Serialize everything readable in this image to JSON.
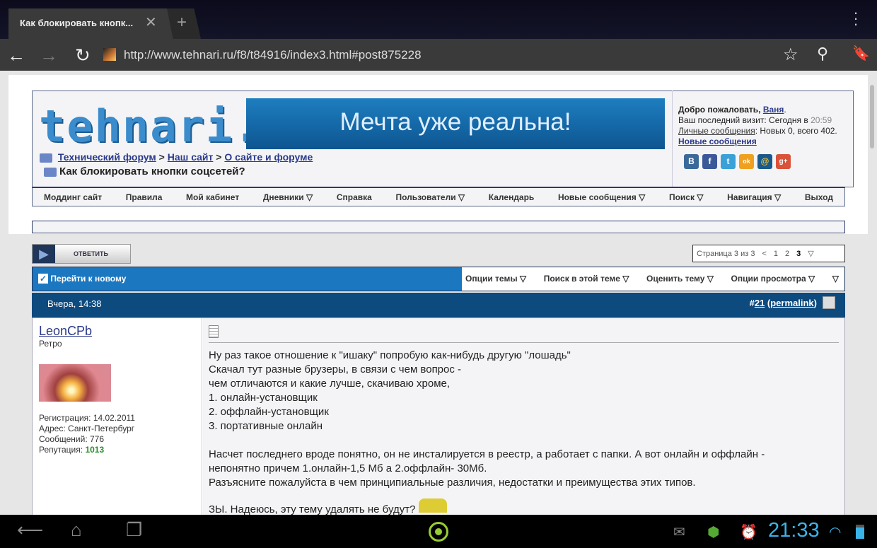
{
  "browser": {
    "tab_title": "Как блокировать кнопк...",
    "url": "http://www.tehnari.ru/f8/t84916/index3.html#post875228"
  },
  "site": {
    "logo": "tehnari.ru",
    "banner": "Мечта уже реальна!",
    "breadcrumb": [
      "Технический форум",
      "Наш сайт",
      "О сайте и форуме"
    ],
    "sep": ">",
    "thread_title": "Как блокировать кнопки соцсетей?"
  },
  "welcome": {
    "greeting": "Добро пожаловать,",
    "user": "Ваня",
    "dot": ".",
    "last_visit": "Ваш последний визит: Сегодня в",
    "last_time": "20:59",
    "pm_label": "Личные сообщения",
    "pm_value": ": Новых 0, всего 402.",
    "new_posts": "Новые сообщения",
    "social": [
      "B",
      "f",
      "t",
      "ok",
      "@",
      "g+"
    ]
  },
  "nav": [
    "Моддинг сайт",
    "Правила",
    "Мой кабинет",
    "Дневники ▽",
    "Справка",
    "Пользователи ▽",
    "Календарь",
    "Новые сообщения ▽",
    "Поиск ▽",
    "Навигация ▽",
    "Выход"
  ],
  "reply_label": "ОТВЕТИТЬ",
  "pager": {
    "label": "Страница 3 из 3",
    "prev": "<",
    "pages": [
      "1",
      "2",
      "3"
    ],
    "menu": "▽"
  },
  "thread_tools": {
    "goto_new": "Перейти к новому",
    "options": [
      "Опции темы ▽",
      "Поиск в этой теме ▽",
      "Оценить тему ▽",
      "Опции просмотра ▽",
      "▽"
    ]
  },
  "post": {
    "date": "Вчера, 14:38",
    "hash": "#",
    "number": "21",
    "permalink": "permalink",
    "user": {
      "name": "LeonCPb",
      "title": "Ретро",
      "reg": "Регистрация: 14.02.2011",
      "addr": "Адрес: Санкт-Петербург",
      "posts": "Сообщений: 776",
      "rep_label": "Репутация: ",
      "rep": "1013"
    },
    "lines": [
      "Ну раз такое отношение к \"ишаку\" попробую как-нибудь другую \"лошадь\"",
      "Скачал тут разные брузеры, в связи с чем вопрос -",
      "чем отличаются и какие лучше, скачиваю хроме,",
      "1. онлайн-установщик",
      "2. оффлайн-установщик",
      "3. портативные онлайн",
      "",
      "Насчет последнего вроде понятно, он не инсталируется в реестр, а работает с папки. А вот онлайн и оффлайн -",
      "непонятно причем 1.онлайн-1,5 Мб а 2.оффлайн- 30Мб.",
      "Разъясните пожалуйста в чем принципиальные различия, недостатки и преимущества этих типов.",
      "",
      "ЗЫ. Надеюсь, эту тему удалять не будут?"
    ]
  },
  "system": {
    "clock": "21:33"
  }
}
